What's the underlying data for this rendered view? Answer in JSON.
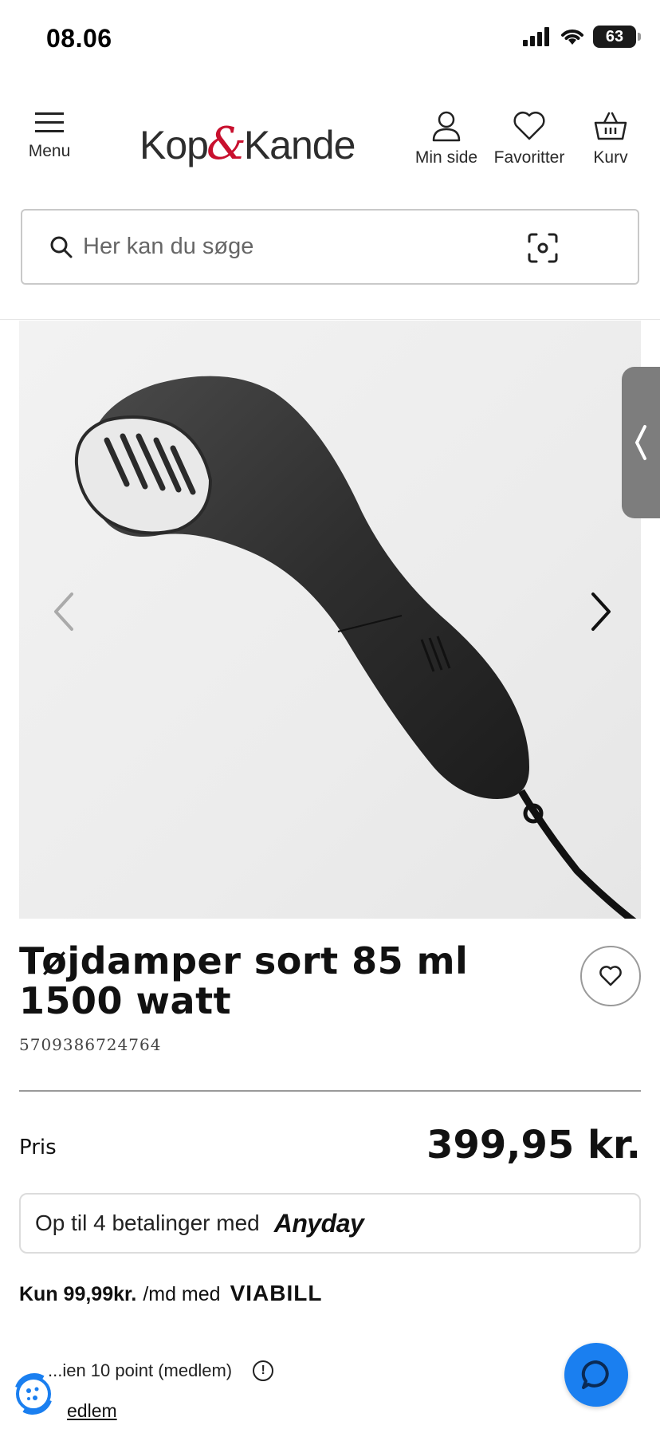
{
  "status": {
    "time": "08.06",
    "battery": "63"
  },
  "header": {
    "menu_label": "Menu",
    "logo_left": "Kop",
    "logo_amp": "&",
    "logo_right": "Kande",
    "account_label": "Min side",
    "favorites_label": "Favoritter",
    "cart_label": "Kurv"
  },
  "search": {
    "placeholder": "Her kan du søge"
  },
  "product": {
    "title": "Tøjdamper sort 85 ml 1500 watt",
    "sku": "5709386724764",
    "price_label": "Pris",
    "price": "399,95 kr."
  },
  "payment": {
    "anyday_text": "Op til 4 betalinger med",
    "anyday_brand": "Anyday",
    "viabill_prefix": "Kun 99,99kr.",
    "viabill_mid": "/md med",
    "viabill_brand": "VIABILL"
  },
  "loyalty": {
    "points_text": "...ien 10 point (medlem)",
    "member_link": "edlem"
  },
  "colors": {
    "accent_red": "#c8102e",
    "chat_blue": "#1a7ff0"
  }
}
